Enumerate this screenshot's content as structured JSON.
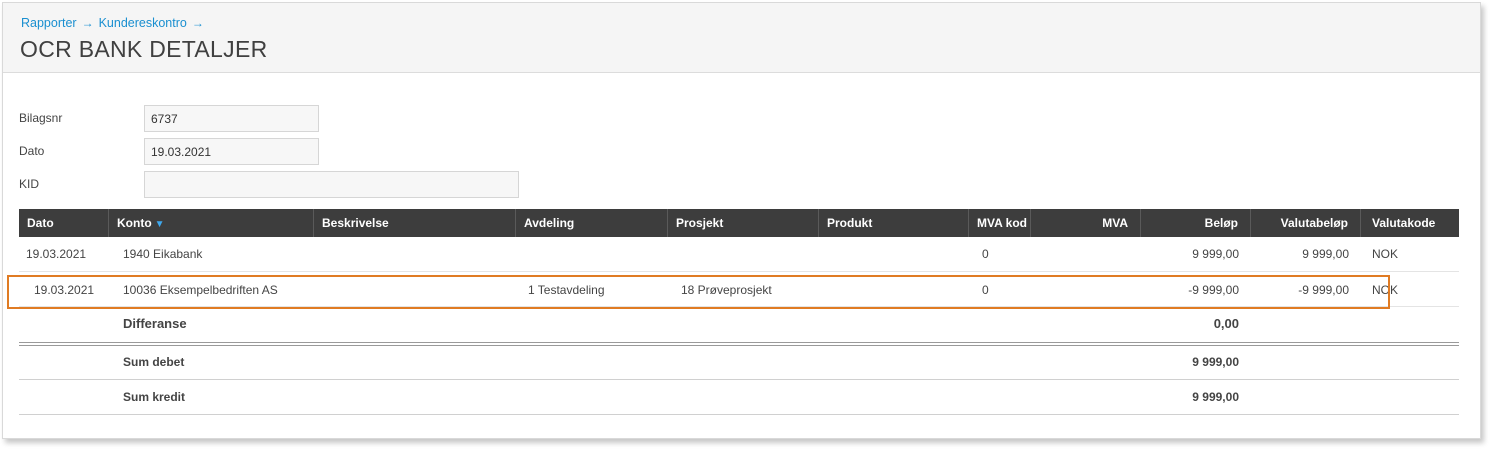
{
  "breadcrumb": {
    "items": [
      "Rapporter",
      "Kundereskontro"
    ],
    "separator": "→"
  },
  "page": {
    "title": "OCR BANK DETALJER"
  },
  "form": {
    "bilagsnr_label": "Bilagsnr",
    "bilagsnr_value": "6737",
    "dato_label": "Dato",
    "dato_value": "19.03.2021",
    "kid_label": "KID",
    "kid_value": ""
  },
  "grid": {
    "columns": {
      "dato": "Dato",
      "konto": "Konto",
      "beskrivelse": "Beskrivelse",
      "avdeling": "Avdeling",
      "prosjekt": "Prosjekt",
      "produkt": "Produkt",
      "mva_kode": "MVA kod",
      "mva": "MVA",
      "belop": "Beløp",
      "valutabelop": "Valutabeløp",
      "valutakode": "Valutakode"
    },
    "sort_icon": "▼",
    "rows": [
      {
        "dato": "19.03.2021",
        "konto": "1940 Eikabank",
        "beskrivelse": "",
        "avdeling": "",
        "prosjekt": "",
        "produkt": "",
        "mva_kode": "0",
        "mva": "",
        "belop": "9 999,00",
        "valutabelop": "9 999,00",
        "valutakode": "NOK"
      },
      {
        "dato": "19.03.2021",
        "konto": "10036 Eksempelbedriften AS",
        "beskrivelse": "",
        "avdeling": "1 Testavdeling",
        "prosjekt": "18 Prøveprosjekt",
        "produkt": "",
        "mva_kode": "0",
        "mva": "",
        "belop": "-9 999,00",
        "valutabelop": "-9 999,00",
        "valutakode": "NOK"
      }
    ],
    "differanse": {
      "label": "Differanse",
      "value": "0,00"
    },
    "sum_debet": {
      "label": "Sum debet",
      "value": "9 999,00"
    },
    "sum_kredit": {
      "label": "Sum kredit",
      "value": "9 999,00"
    }
  },
  "colors": {
    "accent": "#1a8fd0",
    "header_bg": "#3d3d3d",
    "highlight": "#e07b23",
    "sort_icon": "#3fa9ef"
  }
}
